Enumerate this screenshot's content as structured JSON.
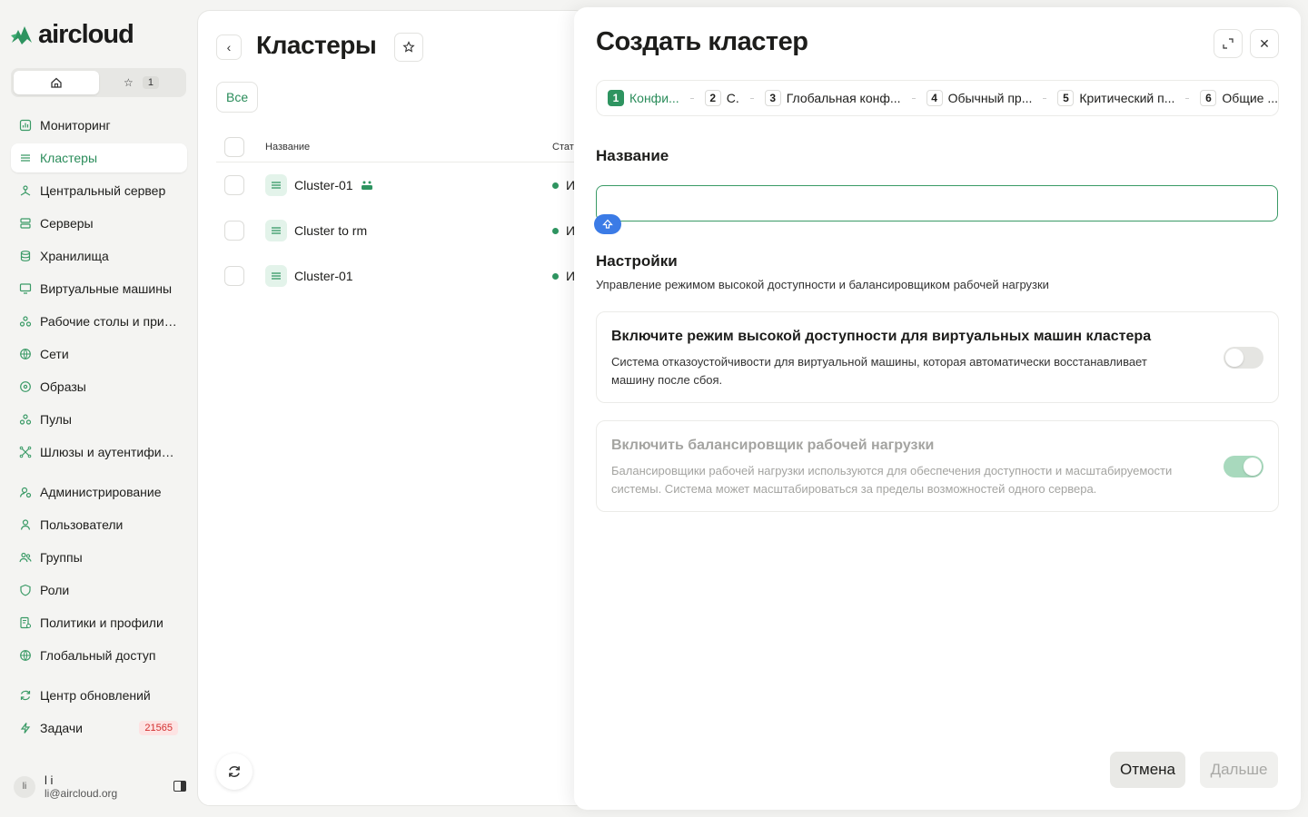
{
  "brand": {
    "name": "aircloud",
    "accent": "#2e9460"
  },
  "quick_access": {
    "favorites_count": "1"
  },
  "sidebar": {
    "items": [
      {
        "label": "Мониторинг",
        "icon": "chart-icon"
      },
      {
        "label": "Кластеры",
        "icon": "layers-icon",
        "active": true
      },
      {
        "label": "Центральный сервер",
        "icon": "network-icon"
      },
      {
        "label": "Серверы",
        "icon": "server-icon"
      },
      {
        "label": "Хранилища",
        "icon": "database-icon"
      },
      {
        "label": "Виртуальные машины",
        "icon": "monitor-icon"
      },
      {
        "label": "Рабочие столы и прил...",
        "icon": "apps-icon"
      },
      {
        "label": "Сети",
        "icon": "globe-icon"
      },
      {
        "label": "Образы",
        "icon": "disc-icon"
      },
      {
        "label": "Пулы",
        "icon": "pool-icon"
      },
      {
        "label": "Шлюзы и аутентифика...",
        "icon": "gateway-icon"
      }
    ],
    "admin_items": [
      {
        "label": "Администрирование",
        "icon": "admin-icon"
      },
      {
        "label": "Пользователи",
        "icon": "user-icon"
      },
      {
        "label": "Группы",
        "icon": "users-icon"
      },
      {
        "label": "Роли",
        "icon": "shield-icon"
      },
      {
        "label": "Политики и профили",
        "icon": "policy-icon"
      },
      {
        "label": "Глобальный доступ",
        "icon": "globe-icon"
      }
    ],
    "bottom_items": [
      {
        "label": "Центр обновлений",
        "icon": "refresh-icon"
      },
      {
        "label": "Задачи",
        "icon": "bolt-icon",
        "badge": "21565"
      }
    ],
    "user": {
      "initials": "li",
      "name": "l i",
      "email": "li@aircloud.org"
    }
  },
  "main": {
    "title": "Кластеры",
    "filter_all": "Все",
    "columns": {
      "name": "Название",
      "status": "Стат"
    },
    "rows": [
      {
        "name": "Cluster-01",
        "status": "И",
        "has_tag": true
      },
      {
        "name": "Cluster to rm",
        "status": "И"
      },
      {
        "name": "Cluster-01",
        "status": "И"
      }
    ]
  },
  "modal": {
    "title": "Создать кластер",
    "steps": [
      {
        "num": "1",
        "label": "Конфи...",
        "active": true
      },
      {
        "num": "2",
        "label": "С."
      },
      {
        "num": "3",
        "label": "Глобальная конф..."
      },
      {
        "num": "4",
        "label": "Обычный пр..."
      },
      {
        "num": "5",
        "label": "Критический п..."
      },
      {
        "num": "6",
        "label": "Общие ..."
      }
    ],
    "name_label": "Название",
    "name_value": "",
    "settings_title": "Настройки",
    "settings_desc": "Управление режимом высокой доступности и балансировщиком рабочей нагрузки",
    "ha_card": {
      "title": "Включите режим высокой доступности для виртуальных машин кластера",
      "desc": "Система отказоустойчивости для виртуальной машины, которая автоматически восстанавливает машину после сбоя.",
      "enabled": false
    },
    "lb_card": {
      "title": "Включить балансировщик рабочей нагрузки",
      "desc": "Балансировщики рабочей нагрузки используются для обеспечения доступности и масштабируемости системы. Система может масштабироваться за пределы возможностей одного сервера.",
      "enabled": true,
      "disabled": true
    },
    "cancel": "Отмена",
    "next": "Дальше"
  }
}
